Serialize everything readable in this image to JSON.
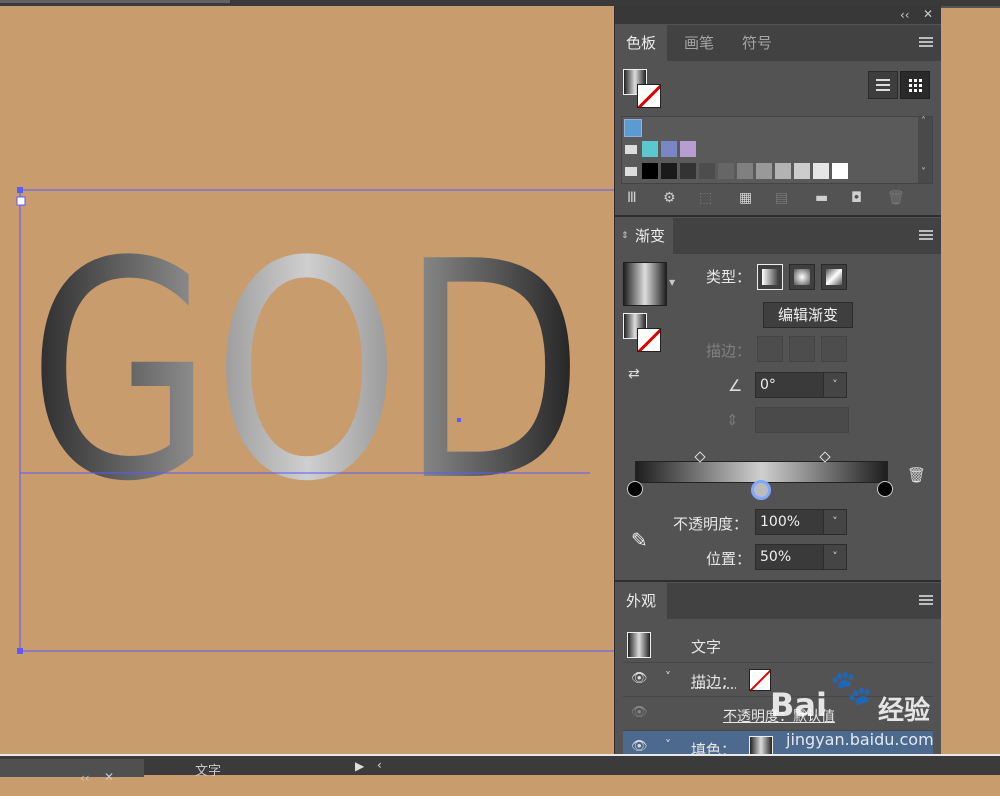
{
  "canvas": {
    "art_text": "GOD"
  },
  "swatches_panel": {
    "tabs": [
      "色板",
      "画笔",
      "符号"
    ],
    "row1_colors": [
      "#5bc8d0",
      "#7b86c4",
      "#b89ed0"
    ],
    "row2_colors": [
      "#000000",
      "#1a1a1a",
      "#333333",
      "#4d4d4d",
      "#666666",
      "#808080",
      "#999999",
      "#b3b3b3",
      "#cccccc",
      "#e6e6e6",
      "#ffffff"
    ]
  },
  "gradient_panel": {
    "title": "渐变",
    "type_label": "类型：",
    "edit_button": "编辑渐变",
    "stroke_label": "描边：",
    "angle_value": "0°",
    "opacity_label": "不透明度：",
    "opacity_value": "100%",
    "position_label": "位置：",
    "position_value": "50%"
  },
  "appearance_panel": {
    "title": "外观",
    "object_label": "文字",
    "stroke_label": "描边：",
    "opacity_label": "不透明度：默认值",
    "fill_label": "填色："
  },
  "bottom_bar": {
    "label": "文字"
  },
  "watermark": {
    "site": "jingyan.baidu.com",
    "brand": "Bai",
    "brand2": "经验"
  }
}
